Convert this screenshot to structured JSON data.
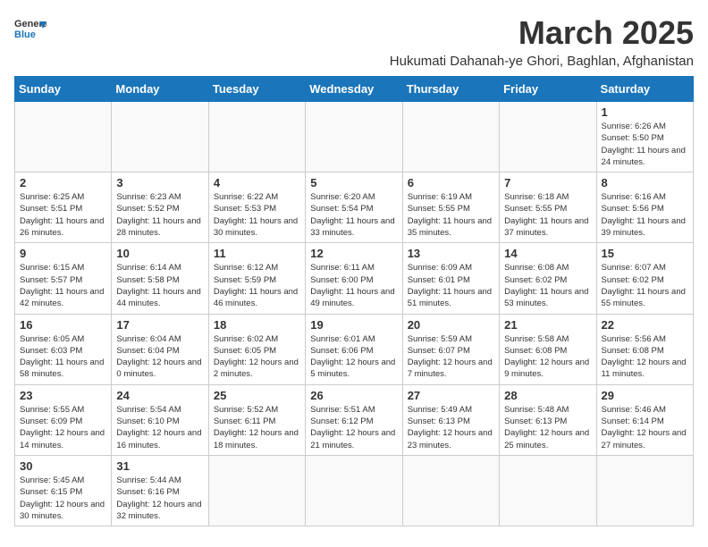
{
  "header": {
    "logo_line1": "General",
    "logo_line2": "Blue",
    "month": "March 2025",
    "subtitle": "Hukumati Dahanah-ye Ghori, Baghlan, Afghanistan"
  },
  "weekdays": [
    "Sunday",
    "Monday",
    "Tuesday",
    "Wednesday",
    "Thursday",
    "Friday",
    "Saturday"
  ],
  "weeks": [
    [
      {
        "day": "",
        "info": ""
      },
      {
        "day": "",
        "info": ""
      },
      {
        "day": "",
        "info": ""
      },
      {
        "day": "",
        "info": ""
      },
      {
        "day": "",
        "info": ""
      },
      {
        "day": "",
        "info": ""
      },
      {
        "day": "1",
        "info": "Sunrise: 6:26 AM\nSunset: 5:50 PM\nDaylight: 11 hours and 24 minutes."
      }
    ],
    [
      {
        "day": "2",
        "info": "Sunrise: 6:25 AM\nSunset: 5:51 PM\nDaylight: 11 hours and 26 minutes."
      },
      {
        "day": "3",
        "info": "Sunrise: 6:23 AM\nSunset: 5:52 PM\nDaylight: 11 hours and 28 minutes."
      },
      {
        "day": "4",
        "info": "Sunrise: 6:22 AM\nSunset: 5:53 PM\nDaylight: 11 hours and 30 minutes."
      },
      {
        "day": "5",
        "info": "Sunrise: 6:20 AM\nSunset: 5:54 PM\nDaylight: 11 hours and 33 minutes."
      },
      {
        "day": "6",
        "info": "Sunrise: 6:19 AM\nSunset: 5:55 PM\nDaylight: 11 hours and 35 minutes."
      },
      {
        "day": "7",
        "info": "Sunrise: 6:18 AM\nSunset: 5:55 PM\nDaylight: 11 hours and 37 minutes."
      },
      {
        "day": "8",
        "info": "Sunrise: 6:16 AM\nSunset: 5:56 PM\nDaylight: 11 hours and 39 minutes."
      }
    ],
    [
      {
        "day": "9",
        "info": "Sunrise: 6:15 AM\nSunset: 5:57 PM\nDaylight: 11 hours and 42 minutes."
      },
      {
        "day": "10",
        "info": "Sunrise: 6:14 AM\nSunset: 5:58 PM\nDaylight: 11 hours and 44 minutes."
      },
      {
        "day": "11",
        "info": "Sunrise: 6:12 AM\nSunset: 5:59 PM\nDaylight: 11 hours and 46 minutes."
      },
      {
        "day": "12",
        "info": "Sunrise: 6:11 AM\nSunset: 6:00 PM\nDaylight: 11 hours and 49 minutes."
      },
      {
        "day": "13",
        "info": "Sunrise: 6:09 AM\nSunset: 6:01 PM\nDaylight: 11 hours and 51 minutes."
      },
      {
        "day": "14",
        "info": "Sunrise: 6:08 AM\nSunset: 6:02 PM\nDaylight: 11 hours and 53 minutes."
      },
      {
        "day": "15",
        "info": "Sunrise: 6:07 AM\nSunset: 6:02 PM\nDaylight: 11 hours and 55 minutes."
      }
    ],
    [
      {
        "day": "16",
        "info": "Sunrise: 6:05 AM\nSunset: 6:03 PM\nDaylight: 11 hours and 58 minutes."
      },
      {
        "day": "17",
        "info": "Sunrise: 6:04 AM\nSunset: 6:04 PM\nDaylight: 12 hours and 0 minutes."
      },
      {
        "day": "18",
        "info": "Sunrise: 6:02 AM\nSunset: 6:05 PM\nDaylight: 12 hours and 2 minutes."
      },
      {
        "day": "19",
        "info": "Sunrise: 6:01 AM\nSunset: 6:06 PM\nDaylight: 12 hours and 5 minutes."
      },
      {
        "day": "20",
        "info": "Sunrise: 5:59 AM\nSunset: 6:07 PM\nDaylight: 12 hours and 7 minutes."
      },
      {
        "day": "21",
        "info": "Sunrise: 5:58 AM\nSunset: 6:08 PM\nDaylight: 12 hours and 9 minutes."
      },
      {
        "day": "22",
        "info": "Sunrise: 5:56 AM\nSunset: 6:08 PM\nDaylight: 12 hours and 11 minutes."
      }
    ],
    [
      {
        "day": "23",
        "info": "Sunrise: 5:55 AM\nSunset: 6:09 PM\nDaylight: 12 hours and 14 minutes."
      },
      {
        "day": "24",
        "info": "Sunrise: 5:54 AM\nSunset: 6:10 PM\nDaylight: 12 hours and 16 minutes."
      },
      {
        "day": "25",
        "info": "Sunrise: 5:52 AM\nSunset: 6:11 PM\nDaylight: 12 hours and 18 minutes."
      },
      {
        "day": "26",
        "info": "Sunrise: 5:51 AM\nSunset: 6:12 PM\nDaylight: 12 hours and 21 minutes."
      },
      {
        "day": "27",
        "info": "Sunrise: 5:49 AM\nSunset: 6:13 PM\nDaylight: 12 hours and 23 minutes."
      },
      {
        "day": "28",
        "info": "Sunrise: 5:48 AM\nSunset: 6:13 PM\nDaylight: 12 hours and 25 minutes."
      },
      {
        "day": "29",
        "info": "Sunrise: 5:46 AM\nSunset: 6:14 PM\nDaylight: 12 hours and 27 minutes."
      }
    ],
    [
      {
        "day": "30",
        "info": "Sunrise: 5:45 AM\nSunset: 6:15 PM\nDaylight: 12 hours and 30 minutes."
      },
      {
        "day": "31",
        "info": "Sunrise: 5:44 AM\nSunset: 6:16 PM\nDaylight: 12 hours and 32 minutes."
      },
      {
        "day": "",
        "info": ""
      },
      {
        "day": "",
        "info": ""
      },
      {
        "day": "",
        "info": ""
      },
      {
        "day": "",
        "info": ""
      },
      {
        "day": "",
        "info": ""
      }
    ]
  ]
}
